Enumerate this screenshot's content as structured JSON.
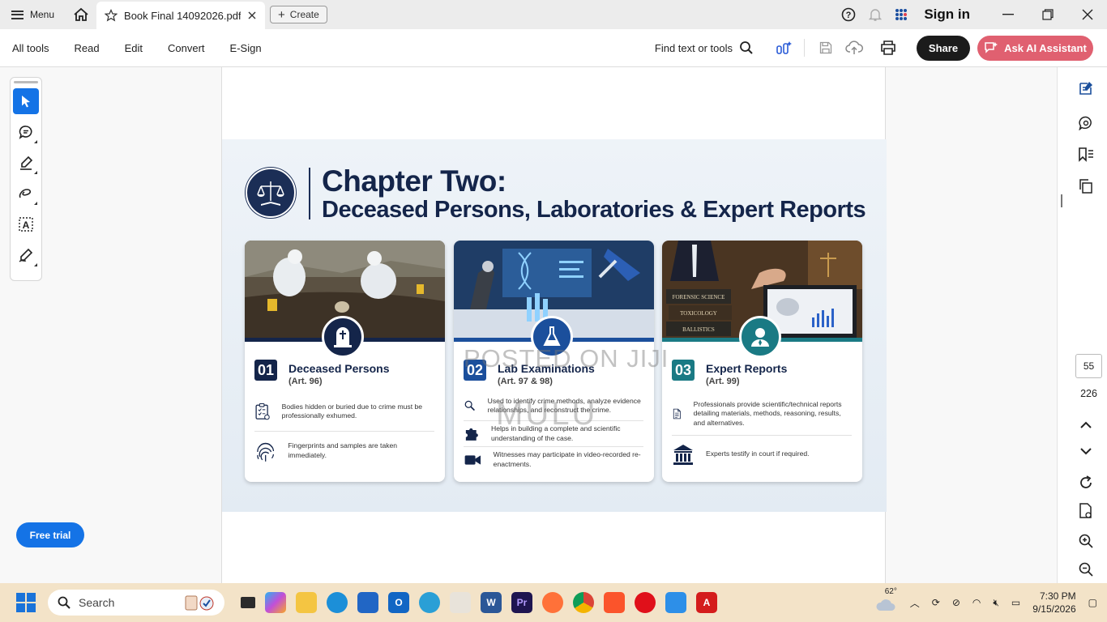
{
  "titlebar": {
    "menu_label": "Menu",
    "tab_title": "Book Final 14092026.pdf",
    "create_label": "Create",
    "sign_in": "Sign in"
  },
  "toolbar": {
    "items": [
      "All tools",
      "Read",
      "Edit",
      "Convert",
      "E-Sign"
    ],
    "find_label": "Find text or tools",
    "share_label": "Share",
    "ai_label": "Ask AI Assistant"
  },
  "left_tools": [
    "select-pointer-icon",
    "comment-icon",
    "highlight-pen-icon",
    "freehand-draw-icon",
    "text-select-icon",
    "sign-pen-icon"
  ],
  "free_trial_label": "Free trial",
  "document": {
    "chapter_title": "Chapter Two:",
    "chapter_subtitle": "Deceased Persons, Laboratories & Expert Reports",
    "cards": [
      {
        "number": "01",
        "title": "Deceased Persons",
        "article": "(Art. 96)",
        "color": "#14254a",
        "rows": [
          {
            "icon": "clipboard-checklist-icon",
            "text": "Bodies hidden or buried due to crime must be professionally exhumed."
          },
          {
            "icon": "fingerprint-icon",
            "text": "Fingerprints and samples are taken immediately."
          }
        ]
      },
      {
        "number": "02",
        "title": "Lab Examinations",
        "article": "(Art. 97 & 98)",
        "color": "#1b4f9c",
        "rows": [
          {
            "icon": "magnifier-icon",
            "text": "Used to identify crime methods, analyze evidence relationships, and reconstruct the crime."
          },
          {
            "icon": "puzzle-icon",
            "text": "Helps in building a complete and scientific understanding of the case."
          },
          {
            "icon": "video-camera-icon",
            "text": "Witnesses may participate in video-recorded re-enactments."
          }
        ]
      },
      {
        "number": "03",
        "title": "Expert Reports",
        "article": "(Art. 99)",
        "color": "#1a7a84",
        "rows": [
          {
            "icon": "document-lines-icon",
            "text": "Professionals provide scientific/technical reports detailing materials, methods, reasoning, results, and alternatives."
          },
          {
            "icon": "courthouse-icon",
            "text": "Experts testify in court if required."
          }
        ]
      }
    ],
    "photo_labels": {
      "books": [
        "FORENSIC SCIENCE",
        "TOXICOLOGY",
        "BALLISTICS"
      ]
    },
    "watermark_line1": "POSTED ON JIJI",
    "watermark_line2": "MULU"
  },
  "page_nav": {
    "current": "55",
    "total": "226"
  },
  "taskbar": {
    "search_placeholder": "Search",
    "weather": "62°",
    "time": "7:30 PM",
    "date": "9/15/2026"
  }
}
